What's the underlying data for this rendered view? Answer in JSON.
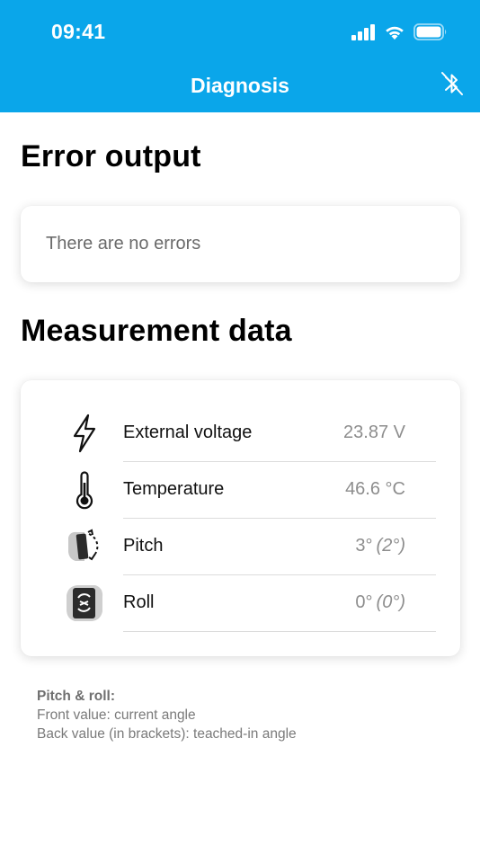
{
  "status_bar": {
    "time": "09:41",
    "icons": [
      "signal-icon",
      "wifi-icon",
      "battery-icon"
    ]
  },
  "nav": {
    "title": "Diagnosis",
    "action_icon": "bluetooth-off-icon"
  },
  "colors": {
    "accent": "#0aa6ea",
    "value_text": "#8d8d8d"
  },
  "error_section": {
    "title": "Error output",
    "message": "There are no errors"
  },
  "measurement_section": {
    "title": "Measurement data",
    "rows": [
      {
        "icon": "lightning-icon",
        "label": "External voltage",
        "value": "23.87 V",
        "sub_value": ""
      },
      {
        "icon": "thermometer-icon",
        "label": "Temperature",
        "value": "46.6 °C",
        "sub_value": ""
      },
      {
        "icon": "pitch-icon",
        "label": "Pitch",
        "value": "3°",
        "sub_value": "(2°)"
      },
      {
        "icon": "roll-icon",
        "label": "Roll",
        "value": "0°",
        "sub_value": "(0°)"
      }
    ]
  },
  "footnote": {
    "title": "Pitch & roll:",
    "line1": "Front value: current angle",
    "line2": "Back value (in brackets): teached-in angle"
  }
}
